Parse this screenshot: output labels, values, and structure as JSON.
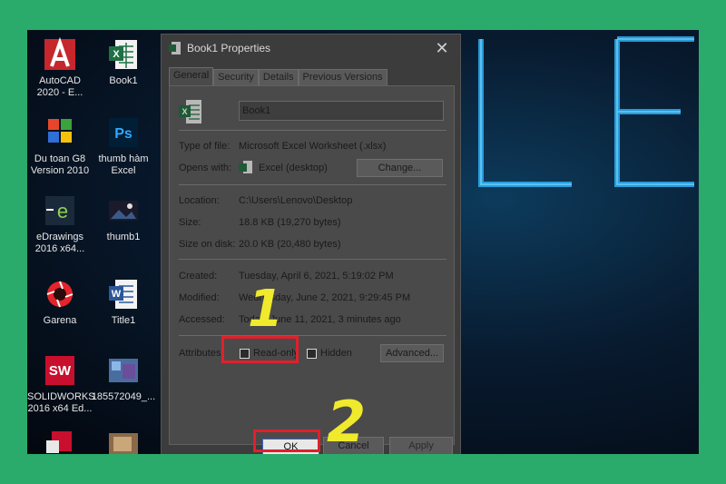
{
  "desktop_icons": [
    {
      "label": "AutoCAD\n2020 - E...",
      "icon": "autocad-icon"
    },
    {
      "label": "Book1",
      "icon": "excel-file-icon"
    },
    {
      "label": "Du toan G8\nVersion 2010",
      "icon": "app-icon"
    },
    {
      "label": "thumb hàm\nExcel",
      "icon": "photoshop-icon"
    },
    {
      "label": "eDrawings\n2016 x64...",
      "icon": "edrawings-icon"
    },
    {
      "label": "thumb1",
      "icon": "image-file-icon"
    },
    {
      "label": "Garena",
      "icon": "garena-icon"
    },
    {
      "label": "Title1",
      "icon": "word-file-icon"
    },
    {
      "label": "SOLIDWORKS\n2016 x64 Ed...",
      "icon": "solidworks-icon"
    },
    {
      "label": "185572049_...",
      "icon": "image-file-icon"
    }
  ],
  "dialog": {
    "title": "Book1 Properties",
    "tabs": [
      "General",
      "Security",
      "Details",
      "Previous Versions"
    ],
    "file_name": "Book1",
    "type_label": "Type of file:",
    "type_value": "Microsoft Excel Worksheet (.xlsx)",
    "opens_label": "Opens with:",
    "opens_value": "Excel (desktop)",
    "change_button": "Change...",
    "location_label": "Location:",
    "location_value": "C:\\Users\\Lenovo\\Desktop",
    "size_label": "Size:",
    "size_value": "18.8 KB (19,270 bytes)",
    "size_disk_label": "Size on disk:",
    "size_disk_value": "20.0 KB (20,480 bytes)",
    "created_label": "Created:",
    "created_value": "Tuesday, April 6, 2021, 5:19:02 PM",
    "modified_label": "Modified:",
    "modified_value": "Wednesday, June 2, 2021, 9:29:45 PM",
    "accessed_label": "Accessed:",
    "accessed_value": "Today, June 11, 2021, 3 minutes ago",
    "attributes_label": "Attributes:",
    "readonly_label": "Read-only",
    "hidden_label": "Hidden",
    "advanced_button": "Advanced...",
    "ok_button": "OK",
    "cancel_button": "Cancel",
    "apply_button": "Apply"
  },
  "annotations": {
    "step1": "1",
    "step2": "2"
  },
  "colors": {
    "background": "#2bab6b",
    "highlight": "#e0202a",
    "annotation": "#f0ea2c"
  }
}
